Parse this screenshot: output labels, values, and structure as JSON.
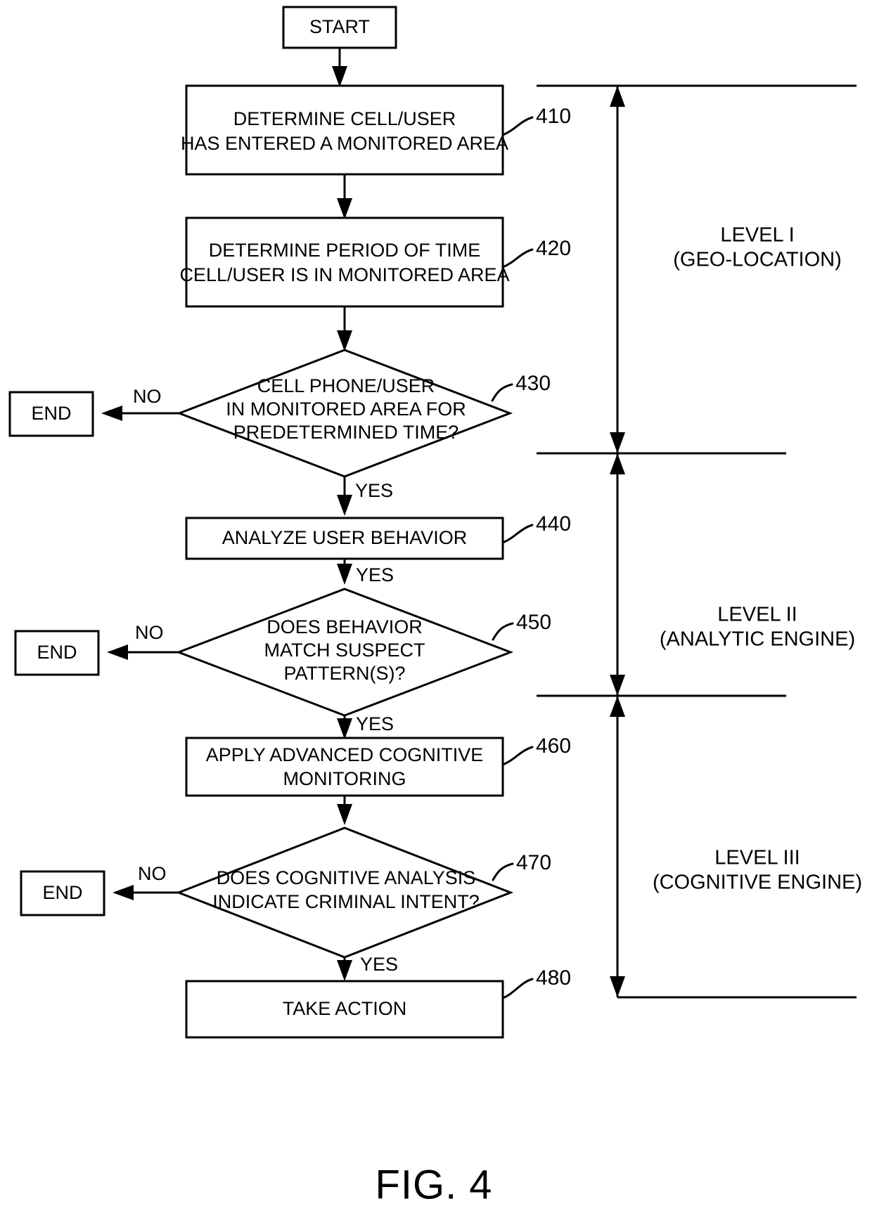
{
  "figure": {
    "caption": "FIG. 4"
  },
  "nodes": {
    "start": {
      "label": "START"
    },
    "step_410": {
      "line1": "DETERMINE CELL/USER",
      "line2": "HAS ENTERED A MONITORED AREA",
      "ref": "410"
    },
    "step_420": {
      "line1": "DETERMINE PERIOD OF TIME",
      "line2": "CELL/USER IS IN MONITORED AREA",
      "ref": "420"
    },
    "decision_430": {
      "line1": "CELL PHONE/USER",
      "line2": "IN MONITORED AREA FOR",
      "line3": "PREDETERMINED TIME?",
      "ref": "430"
    },
    "step_440": {
      "line1": "ANALYZE USER BEHAVIOR",
      "ref": "440"
    },
    "decision_450": {
      "line1": "DOES BEHAVIOR",
      "line2": "MATCH SUSPECT",
      "line3": "PATTERN(S)?",
      "ref": "450"
    },
    "step_460": {
      "line1": "APPLY ADVANCED COGNITIVE",
      "line2": "MONITORING",
      "ref": "460"
    },
    "decision_470": {
      "line1": "DOES COGNITIVE ANALYSIS",
      "line2": "INDICATE CRIMINAL INTENT?",
      "ref": "470"
    },
    "step_480": {
      "line1": "TAKE ACTION",
      "ref": "480"
    },
    "end_1": {
      "label": "END"
    },
    "end_2": {
      "label": "END"
    },
    "end_3": {
      "label": "END"
    }
  },
  "edge_labels": {
    "no_430": "NO",
    "yes_430": "YES",
    "yes_440": "YES",
    "no_450": "NO",
    "yes_450": "YES",
    "no_470": "NO",
    "yes_470": "YES"
  },
  "levels": [
    {
      "line1": "LEVEL I",
      "line2": "(GEO-LOCATION)"
    },
    {
      "line1": "LEVEL II",
      "line2": "(ANALYTIC ENGINE)"
    },
    {
      "line1": "LEVEL III",
      "line2": "(COGNITIVE ENGINE)"
    }
  ],
  "colors": {
    "ink": "#000000",
    "paper": "#ffffff"
  }
}
